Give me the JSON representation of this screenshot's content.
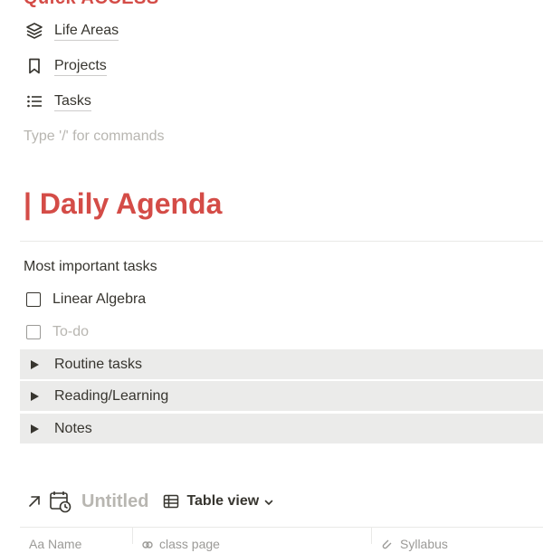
{
  "quick_access": {
    "title": "Quick ACCESS",
    "links": [
      {
        "label": "Life Areas",
        "icon": "layers-icon"
      },
      {
        "label": "Projects",
        "icon": "bookmark-icon"
      },
      {
        "label": "Tasks",
        "icon": "list-icon"
      }
    ],
    "placeholder": "Type '/' for commands"
  },
  "agenda": {
    "title": "| Daily Agenda",
    "subtitle": "Most important tasks",
    "todos": [
      {
        "label": "Linear Algebra",
        "checked": false
      },
      {
        "label": "To-do",
        "checked": false,
        "placeholder": true
      }
    ],
    "toggles": [
      {
        "label": "Routine tasks"
      },
      {
        "label": "Reading/Learning"
      },
      {
        "label": "Notes"
      }
    ]
  },
  "database": {
    "title": "Untitled",
    "view_label": "Table view",
    "columns": [
      "Aa Name",
      "class page",
      "Syllabus"
    ]
  },
  "colors": {
    "accent": "#d44c47",
    "text": "#37352f",
    "muted": "#b8b6b1",
    "toggle_bg": "#ebebea"
  }
}
